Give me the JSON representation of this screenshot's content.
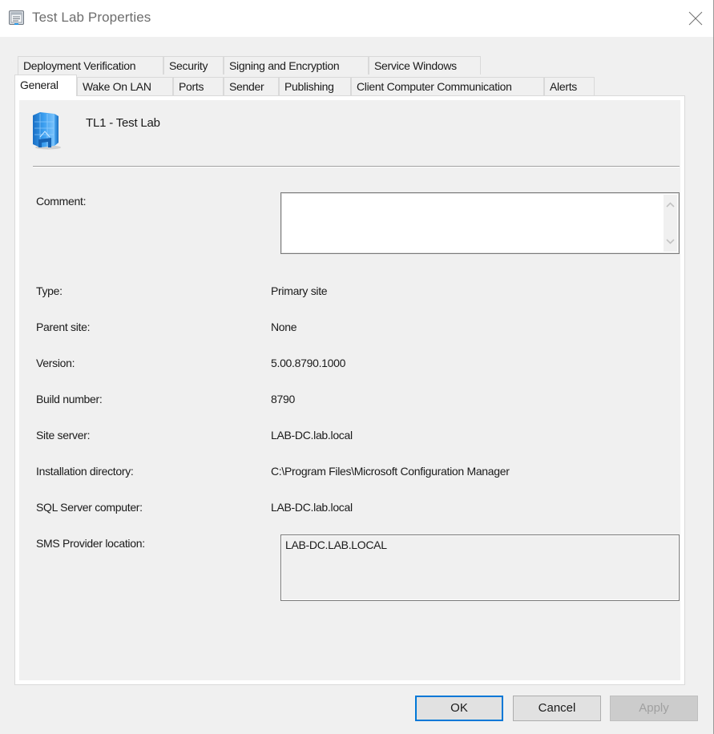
{
  "window": {
    "title": "Test Lab Properties",
    "title_icon": "properties-sheet-icon",
    "close_icon": "close-icon"
  },
  "tabs": {
    "row_back": [
      {
        "label": "Deployment Verification"
      },
      {
        "label": "Security"
      },
      {
        "label": "Signing and Encryption"
      },
      {
        "label": "Service Windows"
      }
    ],
    "row_front": [
      {
        "label": "General",
        "active": true
      },
      {
        "label": "Wake On LAN"
      },
      {
        "label": "Ports"
      },
      {
        "label": "Sender"
      },
      {
        "label": "Publishing"
      },
      {
        "label": "Client Computer Communication"
      },
      {
        "label": "Alerts"
      }
    ]
  },
  "general": {
    "site_icon": "site-server-icon",
    "site_name": "TL1 - Test Lab",
    "comment": {
      "label": "Comment:",
      "value": ""
    },
    "fields": [
      {
        "label": "Type:",
        "value": "Primary site"
      },
      {
        "label": "Parent site:",
        "value": "None"
      },
      {
        "label": "Version:",
        "value": "5.00.8790.1000"
      },
      {
        "label": "Build number:",
        "value": "8790"
      },
      {
        "label": "Site server:",
        "value": "LAB-DC.lab.local"
      },
      {
        "label": "Installation directory:",
        "value": "C:\\Program Files\\Microsoft Configuration Manager"
      },
      {
        "label": "SQL Server computer:",
        "value": "LAB-DC.lab.local"
      }
    ],
    "sms_provider": {
      "label": "SMS Provider location:",
      "values": [
        "LAB-DC.LAB.LOCAL"
      ]
    }
  },
  "buttons": {
    "ok": "OK",
    "cancel": "Cancel",
    "apply": "Apply",
    "apply_enabled": false
  },
  "colors": {
    "accent": "#0078d7",
    "dialog_bg": "#f0f0f0",
    "site_icon_blue": "#2f8ee0"
  }
}
